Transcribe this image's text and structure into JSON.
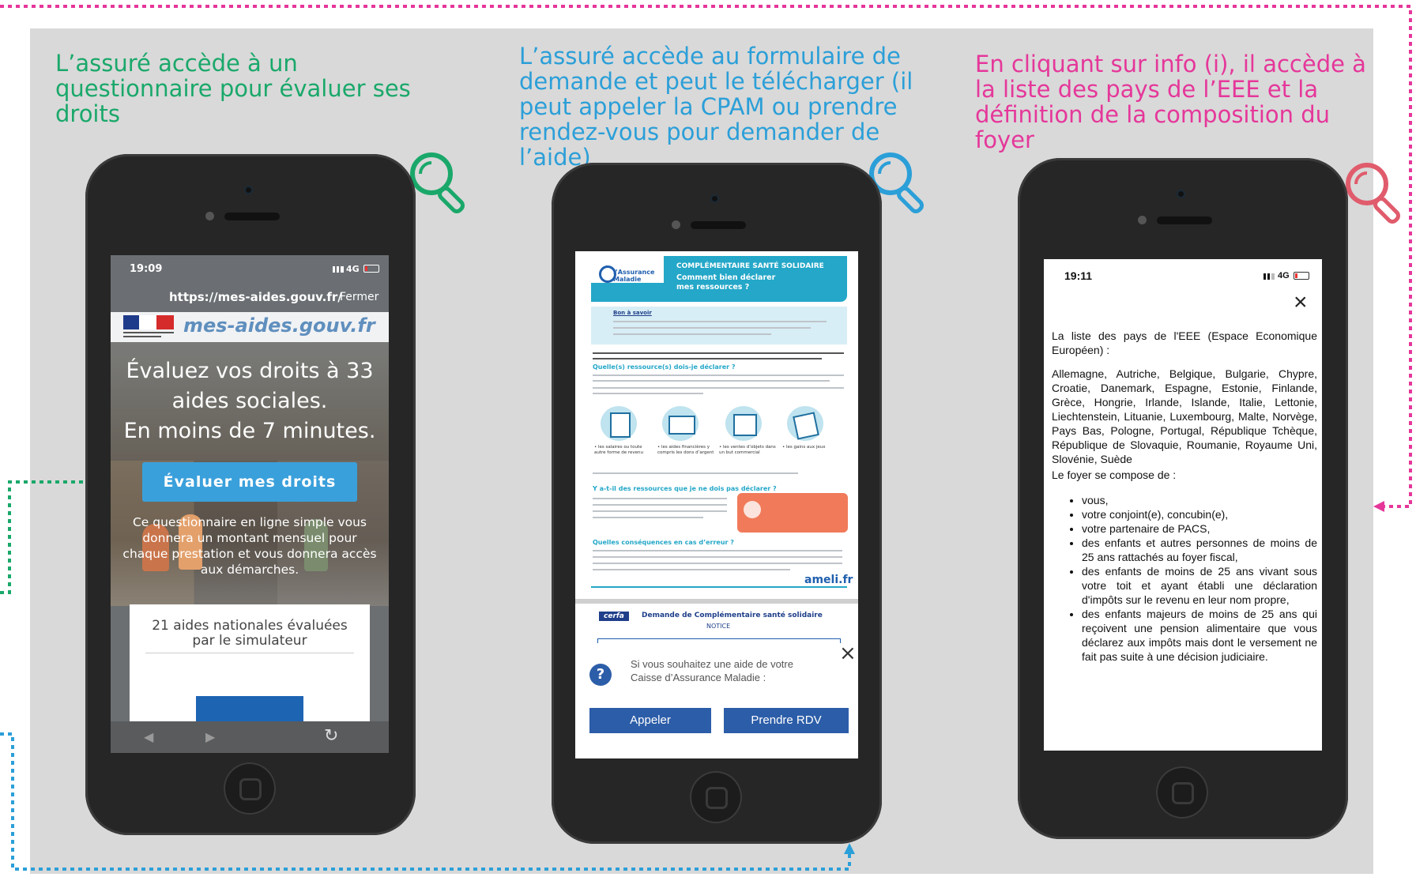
{
  "captions": {
    "col1": "L’assuré accède à un questionnaire pour évaluer ses droits",
    "col2": "L’assuré accède au formulaire de demande et peut le télécharger (il peut appeler la CPAM ou prendre rendez-vous pour demander de l’aide)",
    "col3": "En cliquant sur info (i), il accède à la liste des pays de l’EEE et la définition de la composition du foyer"
  },
  "colors": {
    "green": "#1aa86a",
    "blue": "#2b9fd8",
    "pink": "#e5379a",
    "red_icon": "#e05c6c",
    "panel": "#d9d9d9"
  },
  "screen1": {
    "time": "19:09",
    "network": "4G",
    "url": "https://mes-aides.gouv.fr/",
    "close": "Fermer",
    "logo_text": "mes-aides.gouv.fr",
    "hero_title": "Évaluez vos droits à 33 aides sociales.",
    "hero_subtitle": "En moins de 7 minutes.",
    "cta": "Évaluer mes droits",
    "description": "Ce questionnaire en ligne simple vous donnera un montant mensuel pour chaque prestation et vous donnera accès aux démarches.",
    "card_text": "21 aides nationales évaluées par le simulateur"
  },
  "screen2": {
    "brand": "l’Assurance Maladie",
    "header_title": "COMPLÉMENTAIRE SANTÉ SOLIDAIRE",
    "header_subtitle": "Comment bien déclarer mes ressources ?",
    "bon_a_savoir": "Bon à savoir",
    "section1": "Quelle(s) ressource(s) dois-je déclarer ?",
    "section2": "Y a-t-il des ressources que je ne dois pas déclarer ?",
    "section3": "Quelles conséquences en cas d’erreur ?",
    "icon_labels": [
      "• les salaires ou toute autre forme de revenu",
      "• les aides financières y compris les dons d’argent",
      "• les ventes d’objets dans un but commercial",
      "• les gains aux jeux"
    ],
    "ameli": "ameli.fr",
    "cerfa": "cerfa",
    "form_title": "Demande de Complémentaire santé solidaire",
    "form_sub": "NOTICE",
    "help_text": "Si vous souhaitez une aide de votre Caisse d’Assurance Maladie :",
    "btn_call": "Appeler",
    "btn_rdv": "Prendre RDV"
  },
  "screen3": {
    "time": "19:11",
    "network": "4G",
    "intro": "La liste des pays de l'EEE (Espace Economique Européen) :",
    "countries": "Allemagne, Autriche, Belgique, Bulgarie, Chypre, Croatie, Danemark, Espagne, Estonie, Finlande, Grèce, Hongrie, Irlande, Islande, Italie, Lettonie, Liechtenstein, Lituanie, Luxembourg, Malte, Norvège, Pays Bas, Pologne, Portugal, République Tchèque, République de Slovaquie, Roumanie, Royaume Uni, Slovénie, Suède",
    "foyer_intro": "Le foyer se compose de :",
    "foyer_items": [
      "vous,",
      "votre conjoint(e), concubin(e),",
      "votre partenaire de PACS,",
      "des enfants et autres personnes de moins de 25 ans rattachés au foyer fiscal,",
      "des enfants de moins de 25 ans vivant sous votre toit et ayant établi une déclaration d'impôts sur le revenu en leur nom propre,",
      "des enfants majeurs de moins de 25 ans qui reçoivent une pension alimentaire que vous déclarez aux impôts mais dont le versement ne fait pas suite à une décision judiciaire."
    ]
  }
}
